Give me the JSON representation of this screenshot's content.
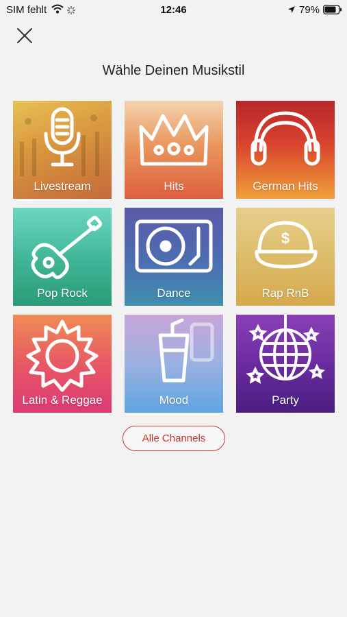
{
  "status_bar": {
    "carrier": "SIM fehlt",
    "time": "12:46",
    "battery": "79%"
  },
  "page_title": "Wähle Deinen Musikstil",
  "genres": [
    {
      "label": "Livestream",
      "icon": "microphone-icon"
    },
    {
      "label": "Hits",
      "icon": "crown-icon"
    },
    {
      "label": "German Hits",
      "icon": "headphones-icon"
    },
    {
      "label": "Pop Rock",
      "icon": "guitar-icon"
    },
    {
      "label": "Dance",
      "icon": "turntable-icon"
    },
    {
      "label": "Rap RnB",
      "icon": "cap-icon"
    },
    {
      "label": "Latin & Reggae",
      "icon": "sun-icon"
    },
    {
      "label": "Mood",
      "icon": "drink-icon"
    },
    {
      "label": "Party",
      "icon": "disco-ball-icon"
    }
  ],
  "all_channels_label": "Alle Channels",
  "colors": {
    "accent": "#cc3a32",
    "background": "#f2f2f2"
  }
}
